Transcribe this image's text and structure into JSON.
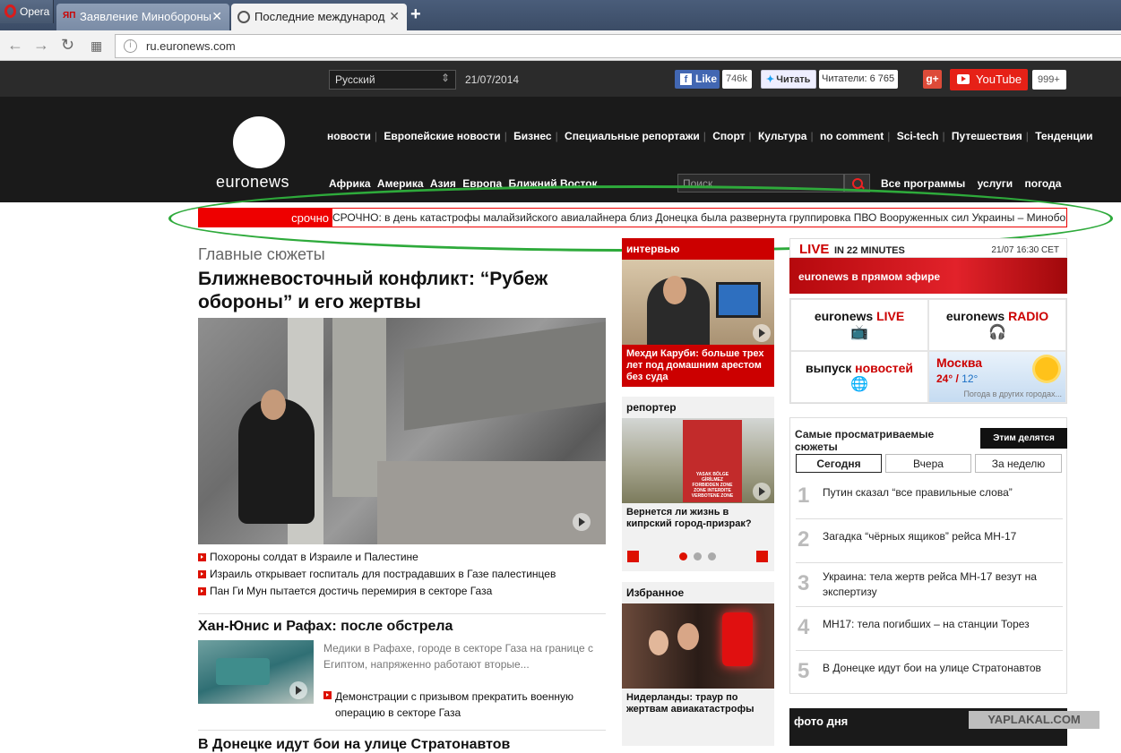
{
  "browser": {
    "menu_label": "Opera",
    "tabs": [
      {
        "favicon": "ЯП",
        "title": "Заявление Минобороны"
      },
      {
        "favicon": "",
        "title": "Последние международ"
      }
    ],
    "url": "ru.euronews.com"
  },
  "topbar": {
    "language": "Русский",
    "date": "21/07/2014",
    "fb_like": "Like",
    "fb_count": "746k",
    "twitter_label": "Читать",
    "twitter_count": "Читатели: 6 765",
    "gplus": "g+",
    "youtube": "YouTube",
    "youtube_count": "999+"
  },
  "header": {
    "logo": "euronews",
    "nav_primary": [
      "новости",
      "Европейские новости",
      "Бизнес",
      "Специальные репортажи",
      "Спорт",
      "Культура",
      "no comment",
      "Sci-tech",
      "Путешествия",
      "Тенденции"
    ],
    "nav_regions": [
      "Африка",
      "Америка",
      "Азия",
      "Европа",
      "Ближний Восток"
    ],
    "search_placeholder": "Поиск",
    "nav_secondary": [
      "Все программы",
      "услуги",
      "погода"
    ]
  },
  "ticker": {
    "label": "срочно",
    "text": "СРОЧНО: в день катастрофы малайзийского авиалайнера близ Донецка была развернута группировка ПВО Вооруженных сил Украины – Минобороны"
  },
  "main": {
    "section_title": "Главные сюжеты",
    "headline": "Ближневосточный конфликт: “Рубеж обороны” и его жертвы",
    "related": [
      "Похороны солдат в Израиле и Палестине",
      "Израиль открывает госпиталь для пострадавших в Газе палестинцев",
      "Пан Ги Мун пытается достичь перемирия в секторе Газа"
    ],
    "story2_title": "Хан-Юнис и Рафах: после обстрела",
    "story2_desc": "Медики в Рафахе, городе в секторе Газа на границе с Египтом, напряженно работают вторые...",
    "story2_link": "Демонстрации с призывом прекратить военную операцию в секторе Газа",
    "story3_title": "В Донецке идут бои на улице Стратонавтов"
  },
  "middle": {
    "interview_label": "интервью",
    "interview_caption": "Мехди Каруби: больше трех лет под домашним арестом без суда",
    "reporter_label": "репортер",
    "reporter_caption": "Вернется ли жизнь в кипрский город-призрак?",
    "sign_lines": [
      "YASAK BÖLGE",
      "GİRİLMEZ",
      "FORBIDDEN ZONE",
      "ZONE INTERDITE",
      "VERBOTENE ZONE"
    ],
    "favorites_label": "Избранное",
    "favorites_caption": "Нидерланды: траур по жертвам авиакатастрофы"
  },
  "right": {
    "live_word": "LIVE",
    "live_in": "IN 22 MINUTES",
    "live_time": "21/07 16:30 CET",
    "live_bottom": "euronews в прямом эфире",
    "cells": {
      "live_a": "euronews",
      "live_b": "LIVE",
      "radio_a": "euronews",
      "radio_b": "RADIO",
      "issue_a": "выпуск",
      "issue_b": "новостей"
    },
    "weather": {
      "city": "Москва",
      "temp_hi": "24°",
      "temp_lo": "12°",
      "other": "Погода в других городах..."
    },
    "most_viewed": {
      "tab_active": "Самые просматриваемые сюжеты",
      "tab_other": "Этим делятся",
      "periods": [
        "Сегодня",
        "Вчера",
        "За неделю"
      ],
      "items": [
        {
          "n": "1",
          "text": "Путин сказал “все правильные слова”"
        },
        {
          "n": "2",
          "text": "Загадка “чёрных ящиков” рейса MH-17"
        },
        {
          "n": "3",
          "text": "Украина: тела жертв рейса MH-17 везут на экспертизу"
        },
        {
          "n": "4",
          "text": "MH17: тела погибших – на станции Торез"
        },
        {
          "n": "5",
          "text": "В Донецке идут бои на улице Стратонавтов"
        }
      ]
    },
    "photo_title": "фото дня"
  },
  "watermark": "YAPLAKAL.COM"
}
